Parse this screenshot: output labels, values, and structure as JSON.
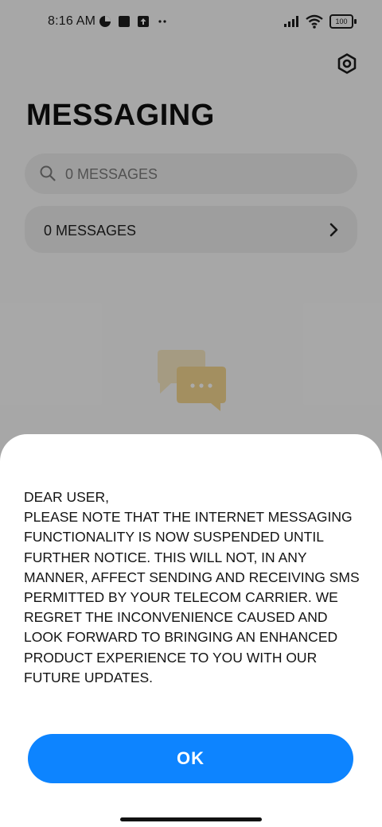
{
  "status_bar": {
    "time": "8:16 AM",
    "battery": "100",
    "left_icons": [
      "data-saver-icon",
      "square-app-icon",
      "upload-icon",
      "more-dots-icon"
    ],
    "right_icons": [
      "signal-icon",
      "wifi-icon",
      "battery-icon"
    ]
  },
  "header": {
    "title": "MESSAGING",
    "settings_icon": "settings-hexagon-icon"
  },
  "search": {
    "placeholder": "0 MESSAGES",
    "icon": "search-icon"
  },
  "messages_row": {
    "label": "0 MESSAGES",
    "icon": "chevron-right-icon"
  },
  "empty_state": {
    "icon": "chat-bubbles-icon"
  },
  "dialog": {
    "lines": [
      "DEAR USER,",
      "PLEASE NOTE THAT THE INTERNET MESSAGING FUNCTIONALITY IS NOW SUSPENDED UNTIL FURTHER NOTICE. THIS WILL NOT, IN ANY MANNER, AFFECT SENDING AND RECEIVING SMS PERMITTED BY YOUR TELECOM CARRIER. WE REGRET THE INCONVENIENCE CAUSED AND LOOK FORWARD TO BRINGING AN ENHANCED PRODUCT EXPERIENCE TO YOU WITH OUR FUTURE UPDATES."
    ],
    "ok_label": "OK"
  },
  "colors": {
    "accent": "#0d84ff",
    "bubble_back": "#f6e7c2",
    "bubble_front": "#f3d68f"
  }
}
